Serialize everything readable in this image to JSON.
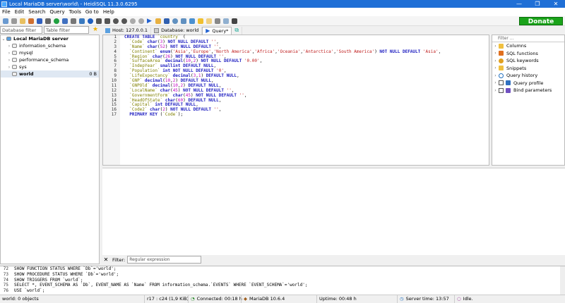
{
  "window": {
    "title": "Local MariaDB server\\world\\ - HeidiSQL 11.3.0.6295"
  },
  "menu": [
    "File",
    "Edit",
    "Search",
    "Query",
    "Tools",
    "Go to",
    "Help"
  ],
  "donate": "Donate",
  "filters": {
    "database": "Database filter",
    "table": "Table filter"
  },
  "tree": {
    "server": "Local MariaDB server",
    "databases": [
      {
        "name": "information_schema",
        "size": ""
      },
      {
        "name": "mysql",
        "size": ""
      },
      {
        "name": "performance_schema",
        "size": ""
      },
      {
        "name": "sys",
        "size": ""
      },
      {
        "name": "world",
        "size": "0 B"
      }
    ]
  },
  "tabs": {
    "host": "Host: 127.0.0.1",
    "database": "Database: world",
    "query": "Query*"
  },
  "editor": {
    "line_numbers": [
      "1",
      "2",
      "3",
      "4",
      "5",
      "6",
      "7",
      "8",
      "9",
      "10",
      "11",
      "12",
      "13",
      "14",
      "15",
      "16",
      "17"
    ],
    "lines": [
      "CREATE TABLE `country` (",
      "  `Code` char(3) NOT NULL DEFAULT '',",
      "  `Name` char(52) NOT NULL DEFAULT '',",
      "  `Continent` enum('Asia','Europe','North America','Africa','Oceania','Antarctica','South America') NOT NULL DEFAULT 'Asia',",
      "  `Region` char(26) NOT NULL DEFAULT '',",
      "  `SurfaceArea` decimal(10,2) NOT NULL DEFAULT '0.00',",
      "  `IndepYear` smallint DEFAULT NULL,",
      "  `Population` int NOT NULL DEFAULT '0',",
      "  `LifeExpectancy` decimal(3,1) DEFAULT NULL,",
      "  `GNP` decimal(10,2) DEFAULT NULL,",
      "  `GNPOld` decimal(10,2) DEFAULT NULL,",
      "  `LocalName` char(45) NOT NULL DEFAULT '',",
      "  `GovernmentForm` char(45) NOT NULL DEFAULT '',",
      "  `HeadOfState` char(60) DEFAULT NULL,",
      "  `Capital` int DEFAULT NULL,",
      "  `Code2` char(2) NOT NULL DEFAULT '',",
      "  PRIMARY KEY (`Code`);"
    ]
  },
  "helpers": {
    "filter_placeholder": "Filter ...",
    "items": [
      "Columns",
      "SQL functions",
      "SQL keywords",
      "Snippets",
      "Query history",
      "Query profile",
      "Bind parameters"
    ]
  },
  "result_filter": {
    "label": "Filter:",
    "placeholder": "Regular expression"
  },
  "log": [
    {
      "n": "72",
      "text": "SHOW FUNCTION STATUS WHERE `Db`='world';"
    },
    {
      "n": "73",
      "text": "SHOW PROCEDURE STATUS WHERE `Db`='world';"
    },
    {
      "n": "74",
      "text": "SHOW TRIGGERS FROM `world`;"
    },
    {
      "n": "75",
      "text": "SELECT *, EVENT_SCHEMA AS `Db`, EVENT_NAME AS `Name` FROM information_schema.`EVENTS` WHERE `EVENT_SCHEMA`='world';"
    },
    {
      "n": "76",
      "text": "USE `world`;"
    }
  ],
  "status": {
    "objects": "world: 0 objects",
    "cursor": "r17 : c24 (1,9 KiB)",
    "connected": "Connected: 00:18 h",
    "server": "MariaDB 10.6.4",
    "uptime": "Uptime: 00:48 h",
    "server_time": "Server time: 13:57",
    "state": "Idle."
  },
  "colors": {
    "titlebar": "#1f6fd6",
    "donate": "#1aa31a",
    "keyword": "#1c1cc0",
    "string": "#c02020",
    "identifier": "#808000"
  }
}
